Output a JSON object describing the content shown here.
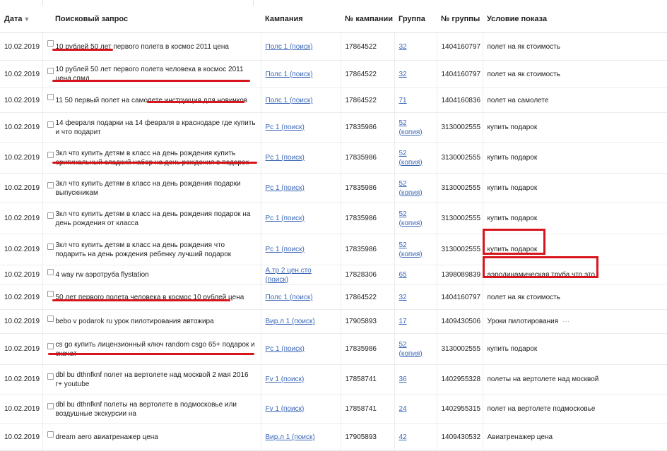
{
  "headers": {
    "date": "Дата",
    "query": "Поисковый запрос",
    "campaign": "Кампания",
    "campaign_no": "№ кампании",
    "group": "Группа",
    "group_no": "№ группы",
    "condition": "Условие показа"
  },
  "sort_indicator": "▼",
  "accent_color": "#d8141c",
  "link_color": "#3a66b7",
  "rows": [
    {
      "date": "10.02.2019",
      "query": "10 рублей 50 лет первого полета в космос 2011 цена",
      "campaign": "Полс 1 (поиск)",
      "campaign_no": "17864522",
      "group": "32",
      "group_no": "1404160797",
      "condition": "полет на як стоимость"
    },
    {
      "date": "10.02.2019",
      "query": "10 рублей 50 лет первого полета человека в космос 2011 цена спмд",
      "campaign": "Полс 1 (поиск)",
      "campaign_no": "17864522",
      "group": "32",
      "group_no": "1404160797",
      "condition": "полет на як стоимость"
    },
    {
      "date": "10.02.2019",
      "query": "11 50 первый полет на самолете инструкция для новичков",
      "campaign": "Полс 1 (поиск)",
      "campaign_no": "17864522",
      "group": "71",
      "group_no": "1404160836",
      "condition": "полет на самолете"
    },
    {
      "date": "10.02.2019",
      "query": "14 февраля подарки на 14 февраля в краснодаре где купить и что подарит",
      "campaign": "Рс 1 (поиск)",
      "campaign_no": "17835986",
      "group": "52 (копия)",
      "group_no": "3130002555",
      "condition": "купить подарок"
    },
    {
      "date": "10.02.2019",
      "query": "3кл что купить детям в класс на день рождения купить оригинальный сладкий набор на день рождения в подарок",
      "campaign": "Рс 1 (поиск)",
      "campaign_no": "17835986",
      "group": "52 (копия)",
      "group_no": "3130002555",
      "condition": "купить подарок"
    },
    {
      "date": "10.02.2019",
      "query": "3кл что купить детям в класс на день рождения подарки выпускникам",
      "campaign": "Рс 1 (поиск)",
      "campaign_no": "17835986",
      "group": "52 (копия)",
      "group_no": "3130002555",
      "condition": "купить подарок"
    },
    {
      "date": "10.02.2019",
      "query": "3кл что купить детям в класс на день рождения подарок на день рождения от класса",
      "campaign": "Рс 1 (поиск)",
      "campaign_no": "17835986",
      "group": "52 (копия)",
      "group_no": "3130002555",
      "condition": "купить подарок"
    },
    {
      "date": "10.02.2019",
      "query": "3кл что купить детям в класс на день рождения что подарить на день рождения ребенку лучший подарок",
      "campaign": "Рс 1 (поиск)",
      "campaign_no": "17835986",
      "group": "52 (копия)",
      "group_no": "3130002555",
      "condition": "купить подарок"
    },
    {
      "date": "10.02.2019",
      "query": "4 way rw аэротруба flystation",
      "campaign": "А.тр 2 цен.сто (поиск)",
      "campaign_no": "17828306",
      "group": "65",
      "group_no": "1398089839",
      "condition": "аэродинамическая труба что это"
    },
    {
      "date": "10.02.2019",
      "query": "50 лет первого полета человека в космос 10 рублей цена",
      "campaign": "Полс 1 (поиск)",
      "campaign_no": "17864522",
      "group": "32",
      "group_no": "1404160797",
      "condition": "полет на як стоимость"
    },
    {
      "date": "10.02.2019",
      "query": "bebo v podarok ru урок пилотирования автожира",
      "campaign": "Вир.л 1 (поиск)",
      "campaign_no": "17905893",
      "group": "17",
      "group_no": "1409430506",
      "condition": "Уроки пилотирования"
    },
    {
      "date": "10.02.2019",
      "query": "cs go купить лицензионный ключ random csgo 65+ подарок и скачат",
      "campaign": "Рс 1 (поиск)",
      "campaign_no": "17835986",
      "group": "52 (копия)",
      "group_no": "3130002555",
      "condition": "купить подарок"
    },
    {
      "date": "10.02.2019",
      "query": "dbl bu dthnfknf полет на вертолете над москвой 2 мая 2016 г+ youtube",
      "campaign": "Fv 1 (поиск)",
      "campaign_no": "17858741",
      "group": "36",
      "group_no": "1402955328",
      "condition": "полеты на вертолете над москвой"
    },
    {
      "date": "10.02.2019",
      "query": "dbl bu dthnfknf полеты на вертолете в подмосковье или воздушные экскурсии на",
      "campaign": "Fv 1 (поиск)",
      "campaign_no": "17858741",
      "group": "24",
      "group_no": "1402955315",
      "condition": "полет на вертолете подмосковье"
    },
    {
      "date": "10.02.2019",
      "query": "dream aero авиатренажер цена",
      "campaign": "Вир.л 1 (поиск)",
      "campaign_no": "17905893",
      "group": "42",
      "group_no": "1409430532",
      "condition": "Авиатренажер цена"
    }
  ],
  "more_dots": "···"
}
